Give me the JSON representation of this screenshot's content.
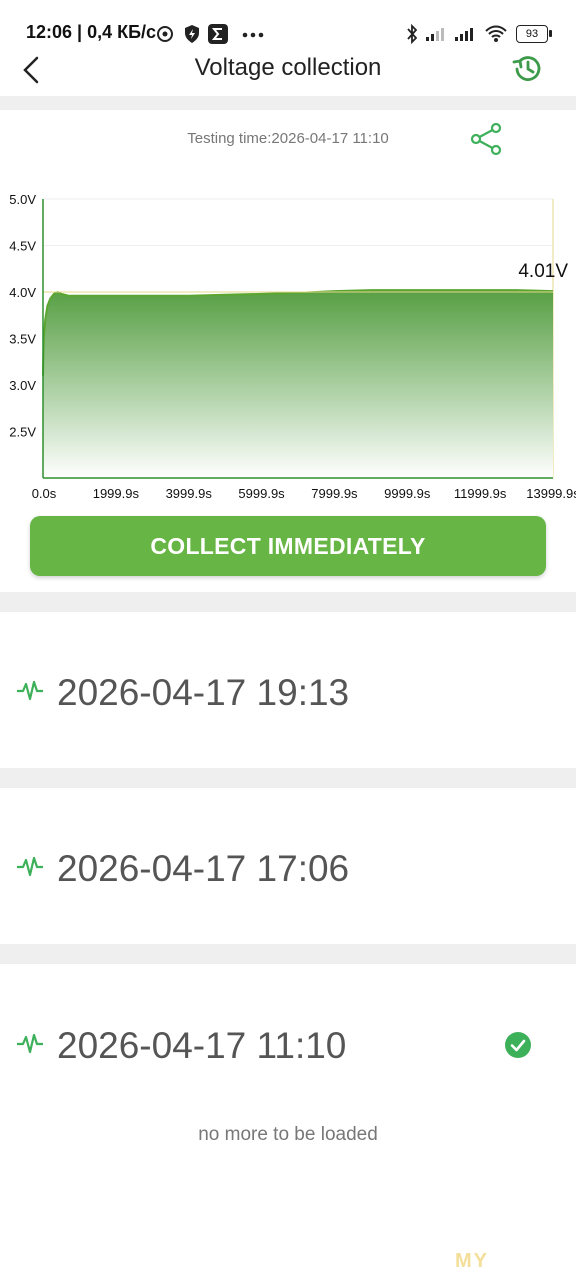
{
  "status_bar": {
    "time": "12:06 | 0,4 КБ/с",
    "battery": "93",
    "icons": [
      "gauge-icon",
      "shield-bolt-icon",
      "sigma-icon",
      "more-dots-icon",
      "bluetooth-icon",
      "signal-icon",
      "signal-icon",
      "wifi-icon",
      "battery-icon"
    ]
  },
  "nav": {
    "title": "Voltage collection",
    "back_icon": "back-arrow-icon",
    "history_icon": "history-clock-icon"
  },
  "testing": {
    "label": "Testing time:2026-04-17 11:10",
    "share_icon": "share-icon"
  },
  "chart_data": {
    "type": "area",
    "x_ticks": [
      "0.0s",
      "1999.9s",
      "3999.9s",
      "5999.9s",
      "7999.9s",
      "9999.9s",
      "11999.9s",
      "13999.9s"
    ],
    "y_ticks": [
      "5.0V",
      "4.5V",
      "4.0V",
      "3.5V",
      "3.0V",
      "2.5V"
    ],
    "xlim": [
      0,
      13999.9
    ],
    "ylim": [
      2.0,
      5.0
    ],
    "x": [
      0,
      20,
      60,
      120,
      200,
      300,
      400,
      500,
      700,
      1000,
      1500,
      2000,
      3000,
      4000,
      5000,
      6000,
      7000,
      7500,
      8000,
      9000,
      10000,
      11000,
      12000,
      13000,
      13999.9
    ],
    "y": [
      3.1,
      3.5,
      3.7,
      3.85,
      3.93,
      3.98,
      4.0,
      3.98,
      3.96,
      3.96,
      3.96,
      3.96,
      3.96,
      3.96,
      3.97,
      3.98,
      3.99,
      4.0,
      4.01,
      4.02,
      4.02,
      4.02,
      4.02,
      4.02,
      4.01
    ],
    "reference_line": 4.0,
    "last_value_label": "4.01V",
    "grid": true,
    "line_color": "#5aa631",
    "fill_top_color": "#4e9a3a",
    "fill_bottom_color": "#ffffff"
  },
  "actions": {
    "collect_label": "COLLECT IMMEDIATELY"
  },
  "records": [
    {
      "time": "2026-04-17 19:13",
      "icon": "pulse-icon",
      "selected": false
    },
    {
      "time": "2026-04-17 17:06",
      "icon": "pulse-icon",
      "selected": false
    },
    {
      "time": "2026-04-17 11:10",
      "icon": "pulse-icon",
      "selected": true
    }
  ],
  "footer": {
    "no_more": "no more to be loaded",
    "watermark": "MY"
  },
  "colors": {
    "accent": "#67b544",
    "band": "#efefef"
  }
}
